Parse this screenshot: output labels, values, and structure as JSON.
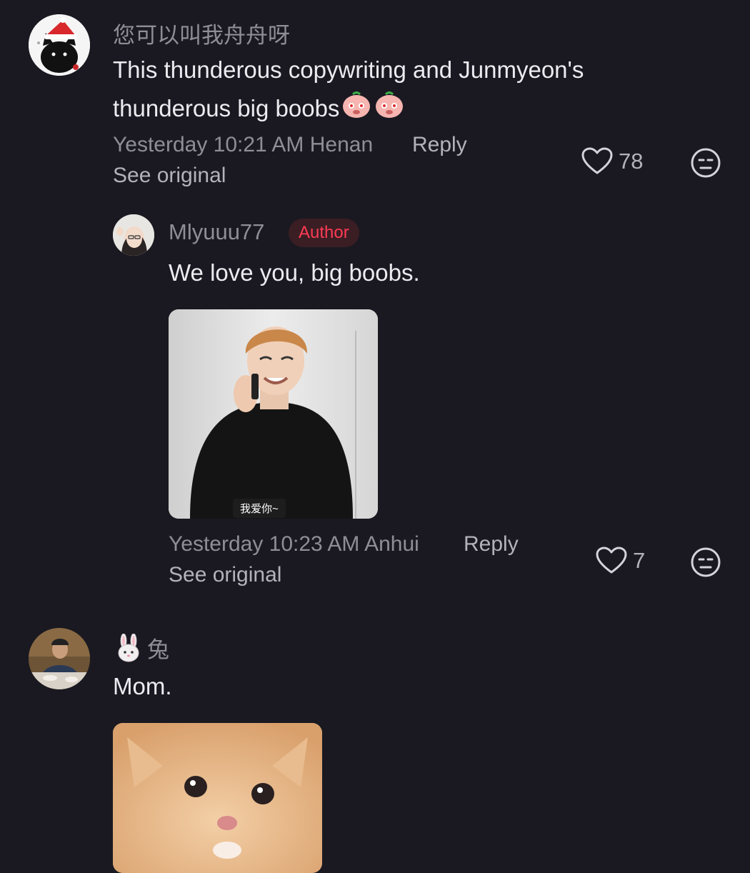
{
  "comments": [
    {
      "username": "您可以叫我舟舟呀",
      "text_line1": "This thunderous copywriting and Junmyeon's",
      "text_line2": "thunderous big boobs",
      "emoji": "peach-blush-emoji",
      "timestamp": "Yesterday 10:21 AM",
      "location": "Henan",
      "reply_label": "Reply",
      "see_original_label": "See original",
      "like_count": "78",
      "avatar_icon": "black-cat-santa-hat-avatar",
      "replies": [
        {
          "username": "Mlyuuu77",
          "badge": "Author",
          "text": "We love you, big boobs.",
          "media_caption": "我爱你~",
          "timestamp": "Yesterday 10:23 AM",
          "location": "Anhui",
          "reply_label": "Reply",
          "see_original_label": "See original",
          "like_count": "7"
        }
      ]
    },
    {
      "username_emoji": "🐰",
      "username": "兔",
      "text": "Mom.",
      "avatar_icon": "man-at-table-avatar",
      "media_icon": "crying-kitten-image"
    }
  ],
  "icons": {
    "like": "heart-outline-icon",
    "dislike": "unamused-face-icon"
  },
  "colors": {
    "background": "#1a1921",
    "primary_text": "#ecebf0",
    "secondary_text": "#8f8e97",
    "action_text": "#b3b2ba",
    "author_badge": "#ff3b55"
  }
}
